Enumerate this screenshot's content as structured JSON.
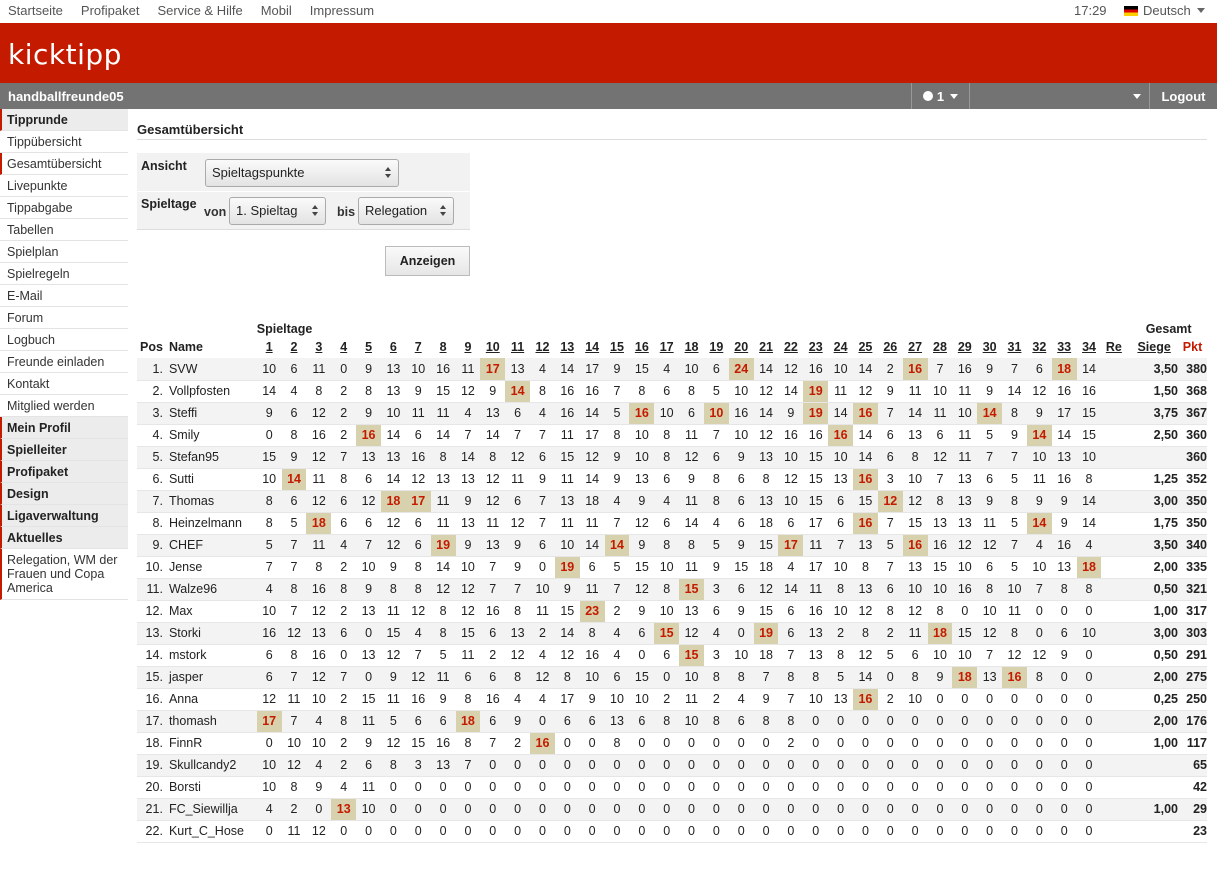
{
  "topnav": {
    "links": [
      "Startseite",
      "Profipaket",
      "Service & Hilfe",
      "Mobil",
      "Impressum"
    ],
    "time": "17:29",
    "language": "Deutsch"
  },
  "brand": {
    "logo": "kicktipp"
  },
  "greybar": {
    "group_name": "handballfreunde05",
    "messages_count": "1",
    "logout_label": "Logout"
  },
  "sidebar": [
    {
      "label": "Tipprunde",
      "head": true
    },
    {
      "label": "Tippübersicht"
    },
    {
      "label": "Gesamtübersicht",
      "active": true
    },
    {
      "label": "Livepunkte"
    },
    {
      "label": "Tippabgabe"
    },
    {
      "label": "Tabellen"
    },
    {
      "label": "Spielplan"
    },
    {
      "label": "Spielregeln"
    },
    {
      "label": "E-Mail"
    },
    {
      "label": "Forum"
    },
    {
      "label": "Logbuch"
    },
    {
      "label": "Freunde einladen"
    },
    {
      "label": "Kontakt"
    },
    {
      "label": "Mitglied werden"
    },
    {
      "label": "Mein Profil",
      "head": true
    },
    {
      "label": "Spielleiter",
      "head": true
    },
    {
      "label": "Profipaket",
      "head": true
    },
    {
      "label": "Design",
      "head": true
    },
    {
      "label": "Ligaverwaltung",
      "head": true
    },
    {
      "label": "Aktuelles",
      "head": true
    },
    {
      "label": "Relegation, WM der Frauen und Copa America",
      "active": true,
      "multi": true
    }
  ],
  "main": {
    "title": "Gesamtübersicht",
    "form": {
      "ansicht_label": "Ansicht",
      "ansicht_value": "Spieltagspunkte",
      "spieltage_label": "Spieltage",
      "von_label": "von",
      "von_value": "1. Spieltag",
      "bis_label": "bis",
      "bis_value": "Relegation",
      "submit_label": "Anzeigen"
    }
  },
  "table": {
    "group_header_spieltage": "Spieltage",
    "group_header_gesamt": "Gesamt",
    "col_pos": "Pos",
    "col_name": "Name",
    "matchdays": [
      "1",
      "2",
      "3",
      "4",
      "5",
      "6",
      "7",
      "8",
      "9",
      "10",
      "11",
      "12",
      "13",
      "14",
      "15",
      "16",
      "17",
      "18",
      "19",
      "20",
      "21",
      "22",
      "23",
      "24",
      "25",
      "26",
      "27",
      "28",
      "29",
      "30",
      "31",
      "32",
      "33",
      "34"
    ],
    "col_re": "Re",
    "col_siege": "Siege",
    "col_pkt": "Pkt",
    "rows": [
      {
        "pos": "1.",
        "name": "SVW",
        "pts": [
          "10",
          "6",
          "11",
          "0",
          "9",
          "13",
          "10",
          "16",
          "11",
          "17",
          "13",
          "4",
          "14",
          "17",
          "9",
          "15",
          "4",
          "10",
          "6",
          "24",
          "14",
          "12",
          "16",
          "10",
          "14",
          "2",
          "16",
          "7",
          "16",
          "9",
          "7",
          "6",
          "18",
          "14"
        ],
        "hi": [
          10,
          20,
          27,
          33
        ],
        "siege": "3,50",
        "pkt": "380"
      },
      {
        "pos": "2.",
        "name": "Vollpfosten",
        "pts": [
          "14",
          "4",
          "8",
          "2",
          "8",
          "13",
          "9",
          "15",
          "12",
          "9",
          "14",
          "8",
          "16",
          "16",
          "7",
          "8",
          "6",
          "8",
          "5",
          "10",
          "12",
          "14",
          "19",
          "11",
          "12",
          "9",
          "11",
          "10",
          "11",
          "9",
          "14",
          "12",
          "16",
          "16"
        ],
        "hi": [
          11,
          23
        ],
        "siege": "1,50",
        "pkt": "368"
      },
      {
        "pos": "3.",
        "name": "Steffi",
        "pts": [
          "9",
          "6",
          "12",
          "2",
          "9",
          "10",
          "11",
          "11",
          "4",
          "13",
          "6",
          "4",
          "16",
          "14",
          "5",
          "16",
          "10",
          "6",
          "10",
          "16",
          "14",
          "9",
          "19",
          "14",
          "16",
          "7",
          "14",
          "11",
          "10",
          "14",
          "8",
          "9",
          "17",
          "15"
        ],
        "hi": [
          16,
          19,
          23,
          25,
          30
        ],
        "siege": "3,75",
        "pkt": "367"
      },
      {
        "pos": "4.",
        "name": "Smily",
        "pts": [
          "0",
          "8",
          "16",
          "2",
          "16",
          "14",
          "6",
          "14",
          "7",
          "14",
          "7",
          "7",
          "11",
          "17",
          "8",
          "10",
          "8",
          "11",
          "7",
          "10",
          "12",
          "16",
          "16",
          "16",
          "14",
          "6",
          "13",
          "6",
          "11",
          "5",
          "9",
          "14",
          "14",
          "15"
        ],
        "hi": [
          5,
          24,
          32
        ],
        "siege": "2,50",
        "pkt": "360"
      },
      {
        "pos": "5.",
        "name": "Stefan95",
        "pts": [
          "15",
          "9",
          "12",
          "7",
          "13",
          "13",
          "16",
          "8",
          "14",
          "8",
          "12",
          "6",
          "15",
          "12",
          "9",
          "10",
          "8",
          "12",
          "6",
          "9",
          "13",
          "10",
          "15",
          "10",
          "14",
          "6",
          "8",
          "12",
          "11",
          "7",
          "7",
          "10",
          "13",
          "10"
        ],
        "hi": [],
        "siege": "",
        "pkt": "360"
      },
      {
        "pos": "6.",
        "name": "Sutti",
        "pts": [
          "10",
          "14",
          "11",
          "8",
          "6",
          "14",
          "12",
          "13",
          "13",
          "12",
          "11",
          "9",
          "11",
          "14",
          "9",
          "13",
          "6",
          "9",
          "8",
          "6",
          "8",
          "12",
          "15",
          "13",
          "16",
          "3",
          "10",
          "7",
          "13",
          "6",
          "5",
          "11",
          "16",
          "8"
        ],
        "hi": [
          2,
          25
        ],
        "siege": "1,25",
        "pkt": "352"
      },
      {
        "pos": "7.",
        "name": "Thomas",
        "pts": [
          "8",
          "6",
          "12",
          "6",
          "12",
          "18",
          "17",
          "11",
          "9",
          "12",
          "6",
          "7",
          "13",
          "18",
          "4",
          "9",
          "4",
          "11",
          "8",
          "6",
          "13",
          "10",
          "15",
          "6",
          "15",
          "12",
          "12",
          "8",
          "13",
          "9",
          "8",
          "9",
          "9",
          "14"
        ],
        "hi": [
          6,
          7,
          26
        ],
        "siege": "3,00",
        "pkt": "350"
      },
      {
        "pos": "8.",
        "name": "Heinzelmann",
        "pts": [
          "8",
          "5",
          "18",
          "6",
          "6",
          "12",
          "6",
          "11",
          "13",
          "11",
          "12",
          "7",
          "11",
          "11",
          "7",
          "12",
          "6",
          "14",
          "4",
          "6",
          "18",
          "6",
          "17",
          "6",
          "16",
          "7",
          "15",
          "13",
          "13",
          "11",
          "5",
          "14",
          "9",
          "14"
        ],
        "hi": [
          3,
          25,
          32
        ],
        "siege": "1,75",
        "pkt": "350"
      },
      {
        "pos": "9.",
        "name": "CHEF",
        "pts": [
          "5",
          "7",
          "11",
          "4",
          "7",
          "12",
          "6",
          "19",
          "9",
          "13",
          "9",
          "6",
          "10",
          "14",
          "14",
          "9",
          "8",
          "8",
          "5",
          "9",
          "15",
          "17",
          "11",
          "7",
          "13",
          "5",
          "16",
          "16",
          "12",
          "12",
          "7",
          "4",
          "16",
          "4"
        ],
        "hi": [
          8,
          15,
          22,
          27
        ],
        "siege": "3,50",
        "pkt": "340"
      },
      {
        "pos": "10.",
        "name": "Jense",
        "pts": [
          "7",
          "7",
          "8",
          "2",
          "10",
          "9",
          "8",
          "14",
          "10",
          "7",
          "9",
          "0",
          "19",
          "6",
          "5",
          "15",
          "10",
          "11",
          "9",
          "15",
          "18",
          "4",
          "17",
          "10",
          "8",
          "7",
          "13",
          "15",
          "10",
          "6",
          "5",
          "10",
          "13",
          "18"
        ],
        "hi": [
          13,
          34
        ],
        "siege": "2,00",
        "pkt": "335"
      },
      {
        "pos": "11.",
        "name": "Walze96",
        "pts": [
          "4",
          "8",
          "16",
          "8",
          "9",
          "8",
          "8",
          "12",
          "12",
          "7",
          "7",
          "10",
          "9",
          "11",
          "7",
          "12",
          "8",
          "15",
          "3",
          "6",
          "12",
          "14",
          "11",
          "8",
          "13",
          "6",
          "10",
          "10",
          "16",
          "8",
          "10",
          "7",
          "8",
          "8"
        ],
        "hi": [
          18
        ],
        "siege": "0,50",
        "pkt": "321"
      },
      {
        "pos": "12.",
        "name": "Max",
        "pts": [
          "10",
          "7",
          "12",
          "2",
          "13",
          "11",
          "12",
          "8",
          "12",
          "16",
          "8",
          "11",
          "15",
          "23",
          "2",
          "9",
          "10",
          "13",
          "6",
          "9",
          "15",
          "6",
          "16",
          "10",
          "12",
          "8",
          "12",
          "8",
          "0",
          "10",
          "11",
          "0",
          "0",
          "0"
        ],
        "hi": [
          14
        ],
        "siege": "1,00",
        "pkt": "317"
      },
      {
        "pos": "13.",
        "name": "Storki",
        "pts": [
          "16",
          "12",
          "13",
          "6",
          "0",
          "15",
          "4",
          "8",
          "15",
          "6",
          "13",
          "2",
          "14",
          "8",
          "4",
          "6",
          "15",
          "12",
          "4",
          "0",
          "19",
          "6",
          "13",
          "2",
          "8",
          "2",
          "11",
          "18",
          "15",
          "12",
          "8",
          "0",
          "6",
          "10"
        ],
        "hi": [
          17,
          21,
          28
        ],
        "siege": "3,00",
        "pkt": "303"
      },
      {
        "pos": "14.",
        "name": "mstork",
        "pts": [
          "6",
          "8",
          "16",
          "0",
          "13",
          "12",
          "7",
          "5",
          "11",
          "2",
          "12",
          "4",
          "12",
          "16",
          "4",
          "0",
          "6",
          "15",
          "3",
          "10",
          "18",
          "7",
          "13",
          "8",
          "12",
          "5",
          "6",
          "10",
          "10",
          "7",
          "12",
          "12",
          "9",
          "0"
        ],
        "hi": [
          18
        ],
        "siege": "0,50",
        "pkt": "291"
      },
      {
        "pos": "15.",
        "name": "jasper",
        "pts": [
          "6",
          "7",
          "12",
          "7",
          "0",
          "9",
          "12",
          "11",
          "6",
          "6",
          "8",
          "12",
          "8",
          "10",
          "6",
          "15",
          "0",
          "10",
          "8",
          "8",
          "7",
          "8",
          "8",
          "5",
          "14",
          "0",
          "8",
          "9",
          "18",
          "13",
          "16",
          "8",
          "0",
          "0"
        ],
        "hi": [
          29,
          31
        ],
        "siege": "2,00",
        "pkt": "275"
      },
      {
        "pos": "16.",
        "name": "Anna",
        "pts": [
          "12",
          "11",
          "10",
          "2",
          "15",
          "11",
          "16",
          "9",
          "8",
          "16",
          "4",
          "4",
          "17",
          "9",
          "10",
          "10",
          "2",
          "11",
          "2",
          "4",
          "9",
          "7",
          "10",
          "13",
          "16",
          "2",
          "10",
          "0",
          "0",
          "0",
          "0",
          "0",
          "0",
          "0"
        ],
        "hi": [
          25
        ],
        "siege": "0,25",
        "pkt": "250"
      },
      {
        "pos": "17.",
        "name": "thomash",
        "pts": [
          "17",
          "7",
          "4",
          "8",
          "11",
          "5",
          "6",
          "6",
          "18",
          "6",
          "9",
          "0",
          "6",
          "6",
          "13",
          "6",
          "8",
          "10",
          "8",
          "6",
          "8",
          "8",
          "0",
          "0",
          "0",
          "0",
          "0",
          "0",
          "0",
          "0",
          "0",
          "0",
          "0",
          "0"
        ],
        "hi": [
          1,
          9
        ],
        "siege": "2,00",
        "pkt": "176"
      },
      {
        "pos": "18.",
        "name": "FinnR",
        "pts": [
          "0",
          "10",
          "10",
          "2",
          "9",
          "12",
          "15",
          "16",
          "8",
          "7",
          "2",
          "16",
          "0",
          "0",
          "8",
          "0",
          "0",
          "0",
          "0",
          "0",
          "0",
          "2",
          "0",
          "0",
          "0",
          "0",
          "0",
          "0",
          "0",
          "0",
          "0",
          "0",
          "0",
          "0"
        ],
        "hi": [
          12
        ],
        "siege": "1,00",
        "pkt": "117"
      },
      {
        "pos": "19.",
        "name": "Skullcandy2",
        "pts": [
          "10",
          "12",
          "4",
          "2",
          "6",
          "8",
          "3",
          "13",
          "7",
          "0",
          "0",
          "0",
          "0",
          "0",
          "0",
          "0",
          "0",
          "0",
          "0",
          "0",
          "0",
          "0",
          "0",
          "0",
          "0",
          "0",
          "0",
          "0",
          "0",
          "0",
          "0",
          "0",
          "0",
          "0"
        ],
        "hi": [],
        "siege": "",
        "pkt": "65"
      },
      {
        "pos": "20.",
        "name": "Borsti",
        "pts": [
          "10",
          "8",
          "9",
          "4",
          "11",
          "0",
          "0",
          "0",
          "0",
          "0",
          "0",
          "0",
          "0",
          "0",
          "0",
          "0",
          "0",
          "0",
          "0",
          "0",
          "0",
          "0",
          "0",
          "0",
          "0",
          "0",
          "0",
          "0",
          "0",
          "0",
          "0",
          "0",
          "0",
          "0"
        ],
        "hi": [],
        "siege": "",
        "pkt": "42"
      },
      {
        "pos": "21.",
        "name": "FC_Siewillja",
        "pts": [
          "4",
          "2",
          "0",
          "13",
          "10",
          "0",
          "0",
          "0",
          "0",
          "0",
          "0",
          "0",
          "0",
          "0",
          "0",
          "0",
          "0",
          "0",
          "0",
          "0",
          "0",
          "0",
          "0",
          "0",
          "0",
          "0",
          "0",
          "0",
          "0",
          "0",
          "0",
          "0",
          "0",
          "0"
        ],
        "hi": [
          4
        ],
        "siege": "1,00",
        "pkt": "29"
      },
      {
        "pos": "22.",
        "name": "Kurt_C_Hose",
        "pts": [
          "0",
          "11",
          "12",
          "0",
          "0",
          "0",
          "0",
          "0",
          "0",
          "0",
          "0",
          "0",
          "0",
          "0",
          "0",
          "0",
          "0",
          "0",
          "0",
          "0",
          "0",
          "0",
          "0",
          "0",
          "0",
          "0",
          "0",
          "0",
          "0",
          "0",
          "0",
          "0",
          "0",
          "0"
        ],
        "hi": [],
        "siege": "",
        "pkt": "23"
      }
    ]
  }
}
